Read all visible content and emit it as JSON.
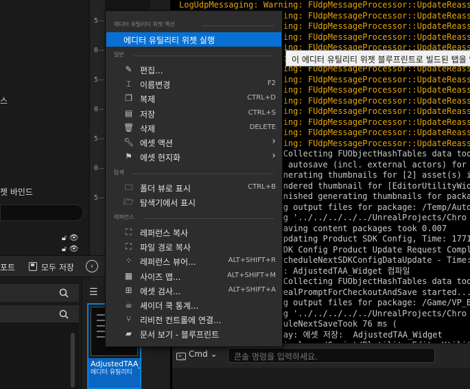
{
  "ruler_labels": [
    "5",
    "0",
    "5",
    "0",
    "5",
    "0",
    "5"
  ],
  "left_panel": {
    "dot_label": "스",
    "bindings_label": "젯 바인드",
    "toolbar_left": "포트",
    "save_all": "모두 저장"
  },
  "asset": {
    "name": "AdjustedTAA_Widget",
    "type": "에디터 유틸리티"
  },
  "context_menu": {
    "sections": {
      "editor_utility": "에디터 유틸리티 위젯 액션",
      "common": "일반",
      "explore": "탐색",
      "references": "레퍼런스"
    },
    "run_item": "에디터 유틸리티 위젯 실행",
    "common_items": [
      {
        "label": "편집...",
        "shortcut": "",
        "icon": "pencil-icon"
      },
      {
        "label": "이름변경",
        "shortcut": "F2",
        "icon": "rename-icon"
      },
      {
        "label": "복제",
        "shortcut": "CTRL+D",
        "icon": "duplicate-icon"
      },
      {
        "label": "저장",
        "shortcut": "CTRL+S",
        "icon": "save-icon"
      },
      {
        "label": "삭제",
        "shortcut": "DELETE",
        "icon": "trash-icon"
      },
      {
        "label": "에셋 액션",
        "shortcut": "",
        "icon": "wrench-icon"
      },
      {
        "label": "에셋 현지화",
        "shortcut": "",
        "icon": "flag-icon"
      }
    ],
    "explore_items": [
      {
        "label": "폴더 뷰로 표시",
        "shortcut": "CTRL+B",
        "icon": "folder-search-icon"
      },
      {
        "label": "탐색기에서 표시",
        "shortcut": "",
        "icon": "explorer-icon"
      }
    ],
    "reference_items": [
      {
        "label": "레퍼런스 복사",
        "shortcut": "",
        "icon": "copy-reference-icon"
      },
      {
        "label": "파일 경로 복사",
        "shortcut": "",
        "icon": "copy-path-icon"
      },
      {
        "label": "레퍼런스 뷰어...",
        "shortcut": "ALT+SHIFT+R",
        "icon": "reference-viewer-icon"
      },
      {
        "label": "사이즈 맵...",
        "shortcut": "ALT+SHIFT+M",
        "icon": "size-map-icon"
      },
      {
        "label": "에셋 검사...",
        "shortcut": "ALT+SHIFT+A",
        "icon": "audit-icon"
      },
      {
        "label": "셰이더 쿡 통계...",
        "shortcut": "",
        "icon": "shader-cook-icon"
      },
      {
        "label": "리비전 컨트롤에 연결...",
        "shortcut": "",
        "icon": "source-control-icon"
      },
      {
        "label": "문서 보기 - 블루프린트",
        "shortcut": "",
        "icon": "docs-icon"
      }
    ]
  },
  "tooltip": "이 에디터 유틸리티 위젯 블루프린트로 빌드된 탭을 엽",
  "log_lines": [
    {
      "text": "LogUdpMessaging: Warning: FUdpMessageProcessor::UpdateReassem",
      "kind": "warn"
    },
    {
      "text": "LogUdpMessaging: Warning: FUdpMessageProcessor::UpdateReassem",
      "kind": "warn"
    },
    {
      "text": "LogUdpMessaging: Warning: FUdpMessageProcessor::UpdateReassem",
      "kind": "warn"
    },
    {
      "text": "LogUdpMessaging: Warning: FUdpMessageProcessor::UpdateReassem",
      "kind": "warn"
    },
    {
      "text": "LogUdpMessaging: Warning: FUdpMessageProcessor::UpdateReassem",
      "kind": "warn"
    },
    {
      "text": "LogUdpMessaging: Warning: FUdpMessageProcessor::UpdateReassem",
      "kind": "warn"
    },
    {
      "text": "LogUdpMessaging: Warning: FUdpMessageProcessor::UpdateReassem",
      "kind": "warn"
    },
    {
      "text": "LogUdpMessaging: Warning: FUdpMessageProcessor::UpdateReassem",
      "kind": "warn"
    },
    {
      "text": "LogUdpMessaging: Warning: FUdpMessageProcessor::UpdateReassem",
      "kind": "warn"
    },
    {
      "text": "LogUdpMessaging: Warning: FUdpMessageProcessor::UpdateReassem",
      "kind": "warn"
    },
    {
      "text": "LogUdpMessaging: Warning: FUdpMessageProcessor::UpdateReassem",
      "kind": "warn"
    },
    {
      "text": "LogUdpMessaging: Warning: FUdpMessageProcessor::UpdateReassem",
      "kind": "warn"
    },
    {
      "text": "LogUdpMessaging: Warning: FUdpMessageProcessor::UpdateReassem",
      "kind": "warn"
    },
    {
      "text": "LogUdpMessaging: Warning: FUdpMessageProcessor::UpdateReassem",
      "kind": "warn"
    },
    {
      "text": "LogDerivedDataCache: Collecting FUObjectHashTables data took   1.2",
      "kind": "info"
    },
    {
      "text": "LogAutosave: Display: autosave (incl. external actors) for",
      "kind": "info"
    },
    {
      "text": "LogContentBrowser: Generating thumbnails for [2] asset(s) in pa",
      "kind": "info"
    },
    {
      "text": "LogContentBrowser: Rendered thumbnail for [EditorUtilityWid",
      "kind": "info"
    },
    {
      "text": "LogContentBrowser: Finished generating thumbnails for package [",
      "kind": "info"
    },
    {
      "text": "LogSavePackage: Moving output files for package: /Temp/Autosa",
      "kind": "info"
    },
    {
      "text": "LogSavePackage: Moving '../../../../../UnrealProjects/Chro",
      "kind": "info"
    },
    {
      "text": "LogFileHelpers: Autosaving content packages took 0.007",
      "kind": "info"
    },
    {
      "text": "LogConfig: Display: Updating Product SDK Config, Time: 17712.9",
      "kind": "info"
    },
    {
      "text": "LogConfig: Display: SDK Config Product Update Request Complete",
      "kind": "info"
    },
    {
      "text": "LogConfig: Display: ScheduleNextSDKConfigDataUpdate - Time: 17",
      "kind": "info"
    },
    {
      "text": "LogBlueprint: Display: AdjustedTAA_Widget 컴파일",
      "kind": "info"
    },
    {
      "text": "LogDerivedDataCache: Collecting FUObjectHashTables data took   1.2",
      "kind": "info"
    },
    {
      "text": "LogSourceControl: UnrealPromptForCheckoutAndSave started...",
      "kind": "info"
    },
    {
      "text": "LogSavePackage: Moving output files for package: /Game/VP_Bas",
      "kind": "info"
    },
    {
      "text": "LogSavePackage: Moving '../../../../../UnrealProjects/Chro",
      "kind": "info"
    },
    {
      "text": "LogFileHelpers: ScheduleNextSaveTook 76 ms (",
      "kind": "info"
    },
    {
      "text": "LogFileHelpers: Display: 에셋 저장:  AdjustedTAA_Widget",
      "kind": "info"
    },
    {
      "text": "LogBlueprintEditor: Display: /Script/Blutility.EditorUtilit",
      "kind": "info"
    }
  ],
  "console": {
    "cmd_label": "Cmd",
    "placeholder": "콘솔 명령을 입력하세요."
  },
  "colors": {
    "highlight": "#0870d2",
    "warning": "#e5a50a",
    "menu_bg": "#2d2d2d"
  }
}
